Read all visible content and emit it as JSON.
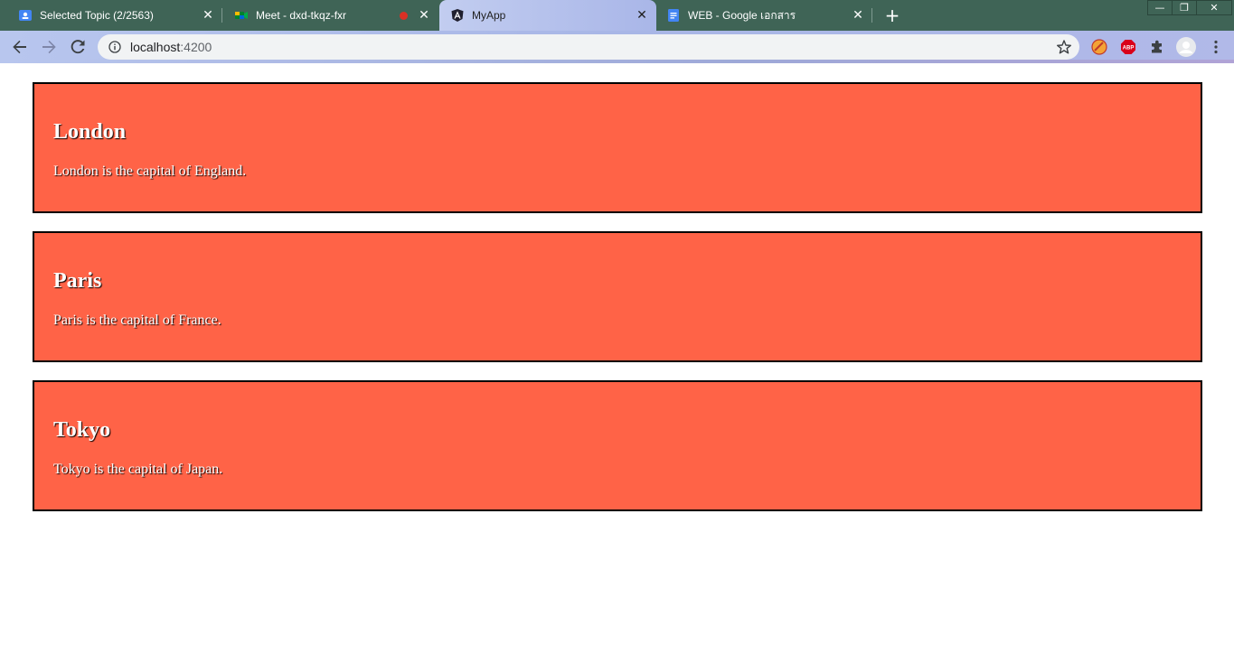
{
  "browser": {
    "tabs": [
      {
        "title": "Selected Topic (2/2563)",
        "icon": "classroom-icon",
        "close": "✕"
      },
      {
        "title": "Meet - dxd-tkqz-fxr",
        "icon": "meet-icon",
        "close": "✕",
        "recording": true
      },
      {
        "title": "MyApp",
        "icon": "angular-icon",
        "close": "✕",
        "active": true
      },
      {
        "title": "WEB - Google เอกสาร",
        "icon": "docs-icon",
        "close": "✕"
      }
    ],
    "new_tab": "+",
    "window_controls": {
      "minimize": "—",
      "restore": "❐",
      "close": "✕"
    },
    "address": {
      "host": "localhost",
      "port": ":4200"
    }
  },
  "cities": [
    {
      "name": "London",
      "description": "London is the capital of England."
    },
    {
      "name": "Paris",
      "description": "Paris is the capital of France."
    },
    {
      "name": "Tokyo",
      "description": "Tokyo is the capital of Japan."
    }
  ],
  "colors": {
    "card_background": "#ff6347",
    "card_border": "#000000",
    "tabstrip": "#3f6456"
  }
}
